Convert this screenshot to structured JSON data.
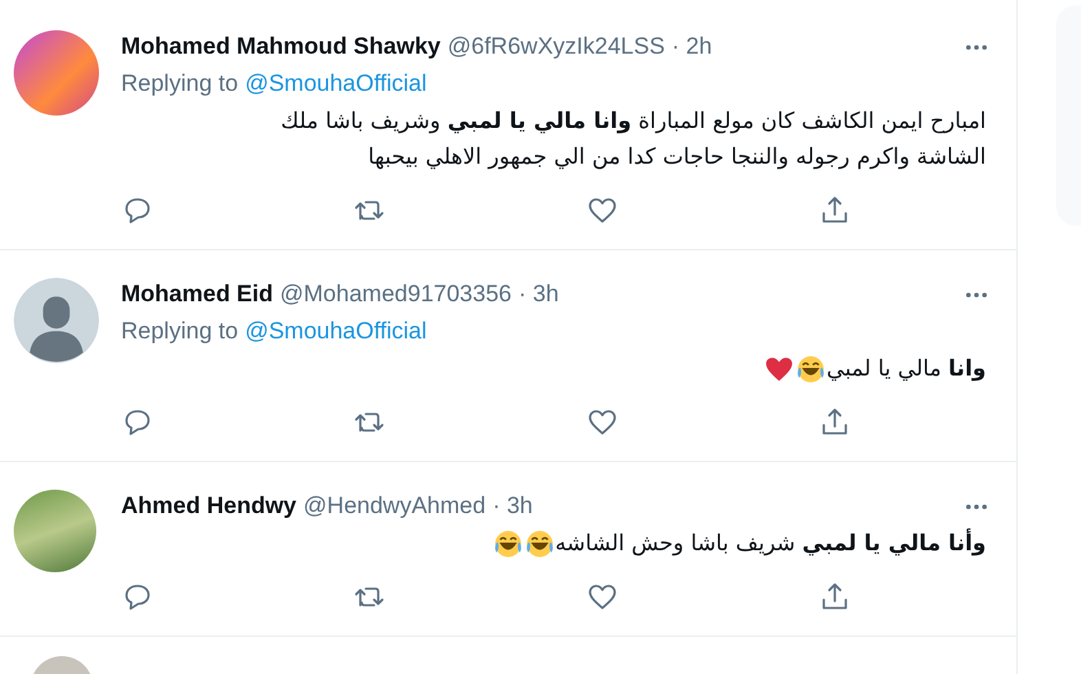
{
  "tweets": [
    {
      "avatar": {
        "kind": "photo"
      },
      "name": "Mohamed Mahmoud Shawky",
      "handle": "@6fR6wXyzIk24LSS",
      "time": "· 2h",
      "replying_label": "Replying to",
      "replying_to": "@SmouhaOfficial",
      "text": "امبارح ايمن الكاشف كان مولع المباراة **وانا مالي يا لمبي** وشريف باشا ملك\nالشاشة واكرم رجوله والننجا  حاجات كدا من الي جمهور الاهلي بيحبها"
    },
    {
      "avatar": {
        "kind": "default"
      },
      "name": "Mohamed Eid",
      "handle": "@Mohamed91703356",
      "time": "· 3h",
      "replying_label": "Replying to",
      "replying_to": "@SmouhaOfficial",
      "text": "**وانا** مالي يا لمبي",
      "emojis": [
        {
          "kind": "laugh"
        },
        {
          "kind": "heart"
        }
      ]
    },
    {
      "avatar": {
        "kind": "photo"
      },
      "name": "Ahmed Hendwy",
      "handle": "@HendwyAhmed",
      "time": "· 3h",
      "text": "**وأنا مالي يا لمبي** شريف باشا وحش الشاشه",
      "emojis": [
        {
          "kind": "laugh"
        },
        {
          "kind": "laugh"
        }
      ]
    }
  ]
}
